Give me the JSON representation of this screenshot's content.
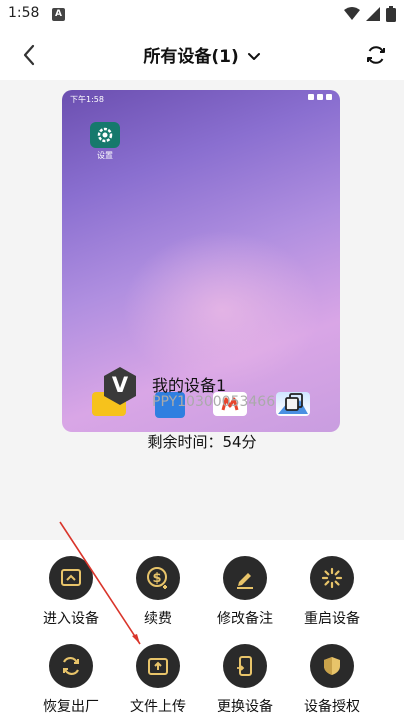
{
  "status_bar": {
    "time": "1:58",
    "app_badge": "A"
  },
  "nav": {
    "title": "所有设备(1)"
  },
  "phone_preview": {
    "status_time": "下午1:58",
    "settings_label": "设置"
  },
  "device": {
    "logo_letter": "V",
    "name": "我的设备1",
    "id": "PPY10300053466",
    "remaining_label": "剩余时间：",
    "remaining_value": "54分"
  },
  "actions": [
    {
      "label": "进入设备",
      "icon": "enter-device-icon"
    },
    {
      "label": "续费",
      "icon": "renew-dollar-icon"
    },
    {
      "label": "修改备注",
      "icon": "edit-note-icon"
    },
    {
      "label": "重启设备",
      "icon": "restart-icon"
    },
    {
      "label": "恢复出厂",
      "icon": "factory-reset-icon"
    },
    {
      "label": "文件上传",
      "icon": "file-upload-icon"
    },
    {
      "label": "更换设备",
      "icon": "replace-device-icon"
    },
    {
      "label": "设备授权",
      "icon": "authorize-shield-icon"
    }
  ],
  "colors": {
    "accent": "#e8c46a",
    "action_bg": "#2a2a2a",
    "content_bg": "#f4f4f4",
    "arrow": "#d9352b"
  }
}
